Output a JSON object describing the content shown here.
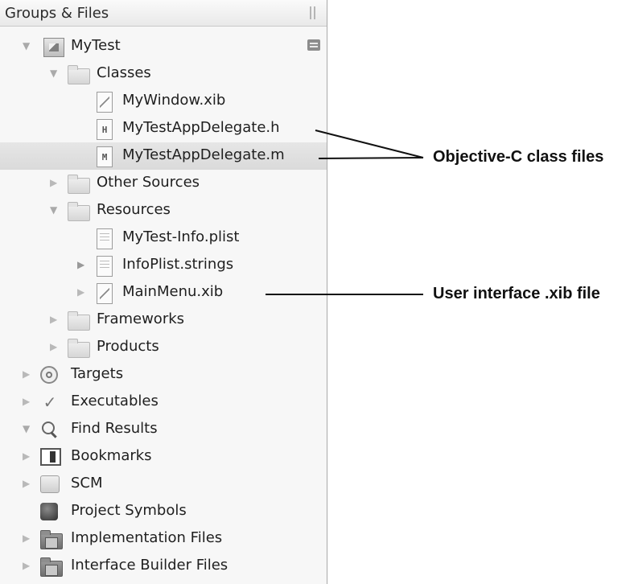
{
  "sidebar": {
    "title": "Groups & Files",
    "items": [
      {
        "label": "MyTest",
        "icon": "project-icon",
        "expander": "open"
      },
      {
        "label": "Classes",
        "icon": "folder-icon",
        "expander": "open"
      },
      {
        "label": "MyWindow.xib",
        "icon": "xib-file-icon",
        "expander": "none"
      },
      {
        "label": "MyTestAppDelegate.h",
        "icon": "header-file-icon",
        "letter": "H",
        "expander": "none"
      },
      {
        "label": "MyTestAppDelegate.m",
        "icon": "implementation-file-icon",
        "letter": "M",
        "expander": "none",
        "selected": true
      },
      {
        "label": "Other Sources",
        "icon": "folder-icon",
        "expander": "closed"
      },
      {
        "label": "Resources",
        "icon": "folder-icon",
        "expander": "open"
      },
      {
        "label": "MyTest-Info.plist",
        "icon": "plist-file-icon",
        "expander": "none"
      },
      {
        "label": "InfoPlist.strings",
        "icon": "strings-file-icon",
        "expander": "closed"
      },
      {
        "label": "MainMenu.xib",
        "icon": "xib-file-icon",
        "expander": "closed"
      },
      {
        "label": "Frameworks",
        "icon": "folder-icon",
        "expander": "closed"
      },
      {
        "label": "Products",
        "icon": "folder-icon",
        "expander": "closed"
      },
      {
        "label": "Targets",
        "icon": "target-icon",
        "expander": "closed"
      },
      {
        "label": "Executables",
        "icon": "executable-check-icon",
        "expander": "closed"
      },
      {
        "label": "Find Results",
        "icon": "magnifier-icon",
        "expander": "open"
      },
      {
        "label": "Bookmarks",
        "icon": "bookmarks-icon",
        "expander": "closed"
      },
      {
        "label": "SCM",
        "icon": "scm-icon",
        "expander": "closed"
      },
      {
        "label": "Project Symbols",
        "icon": "symbols-cube-icon",
        "expander": "none"
      },
      {
        "label": "Implementation Files",
        "icon": "smart-folder-icon",
        "expander": "closed"
      },
      {
        "label": "Interface Builder Files",
        "icon": "smart-folder-icon",
        "expander": "closed"
      }
    ]
  },
  "callouts": {
    "class_files": "Objective-C class files",
    "xib_file": "User interface .xib file"
  },
  "colors": {
    "panel_bg": "#f7f7f7",
    "selected_row": "#dcdcdc",
    "text": "#1f1f1f",
    "callout_text": "#111111"
  }
}
